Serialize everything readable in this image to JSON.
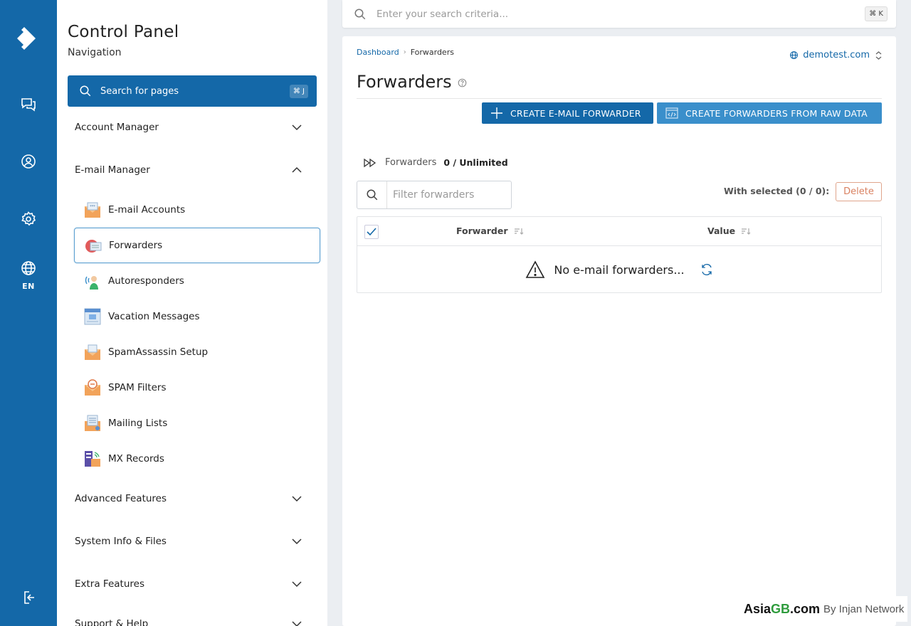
{
  "rail": {
    "items": [
      {
        "name": "chat",
        "icon": "chat-bubbles-icon"
      },
      {
        "name": "user",
        "icon": "user-circle-icon"
      },
      {
        "name": "settings",
        "icon": "gear-icon"
      },
      {
        "name": "language",
        "icon": "globe-icon"
      }
    ],
    "language_label": "EN",
    "logout_icon": "logout-icon"
  },
  "sidebar": {
    "title": "Control Panel",
    "subtitle": "Navigation",
    "search_label": "Search for pages",
    "search_shortcut": "⌘ J",
    "sections": [
      {
        "label": "Account Manager",
        "state": "collapsed"
      },
      {
        "label": "E-mail Manager",
        "state": "expanded"
      },
      {
        "label": "Advanced Features",
        "state": "collapsed"
      },
      {
        "label": "System Info & Files",
        "state": "collapsed"
      },
      {
        "label": "Extra Features",
        "state": "collapsed"
      },
      {
        "label": "Support & Help",
        "state": "collapsed"
      }
    ],
    "email_items": [
      {
        "label": "E-mail Accounts",
        "icon": "email-accounts-icon"
      },
      {
        "label": "Forwarders",
        "icon": "forwarders-icon",
        "active": true
      },
      {
        "label": "Autoresponders",
        "icon": "autoresponders-icon"
      },
      {
        "label": "Vacation Messages",
        "icon": "vacation-messages-icon"
      },
      {
        "label": "SpamAssassin Setup",
        "icon": "spamassassin-icon"
      },
      {
        "label": "SPAM Filters",
        "icon": "spam-filters-icon"
      },
      {
        "label": "Mailing Lists",
        "icon": "mailing-lists-icon"
      },
      {
        "label": "MX Records",
        "icon": "mx-records-icon"
      }
    ]
  },
  "topbar": {
    "search_placeholder": "Enter your search criteria...",
    "shortcut": "⌘ K"
  },
  "main": {
    "breadcrumb": [
      "Dashboard",
      "Forwarders"
    ],
    "domain": "demotest.com",
    "title": "Forwarders",
    "buttons": {
      "create": "CREATE E-MAIL FORWARDER",
      "raw": "CREATE FORWARDERS FROM RAW DATA"
    },
    "count_label": "Forwarders",
    "count_value": "0 / Unlimited",
    "filter_placeholder": "Filter forwarders",
    "with_selected": "With selected (0 / 0):",
    "delete_label": "Delete",
    "columns": [
      "Forwarder",
      "Value"
    ],
    "empty_message": "No e-mail forwarders..."
  },
  "watermark": {
    "brand_prefix": "Asia",
    "brand_highlight": "GB",
    "brand_suffix": ".com",
    "byline": "By Injan Network"
  },
  "colors": {
    "primary": "#1468a8",
    "secondary_button": "#3a8fcb",
    "delete_accent": "#d98060",
    "watermark_green": "#2e9b3c"
  }
}
